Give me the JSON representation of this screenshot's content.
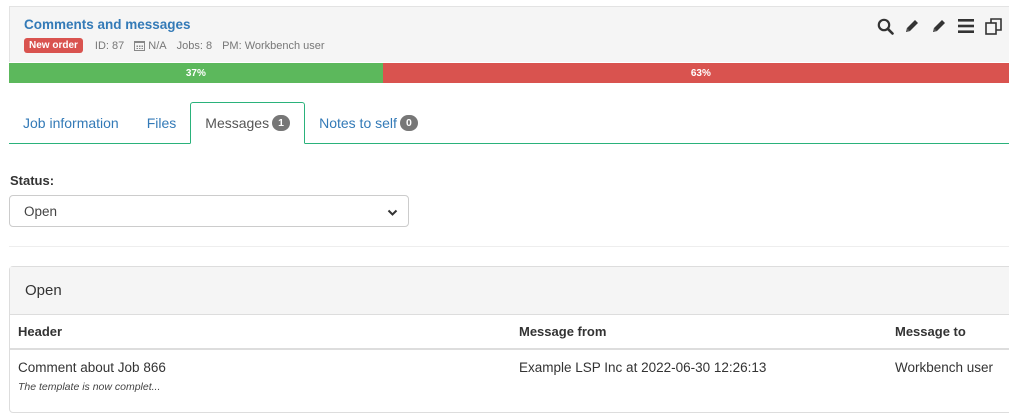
{
  "header": {
    "title": "Comments and messages",
    "badge": "New order",
    "id_text": "ID: 87",
    "date_text": "N/A",
    "jobs_text": "Jobs: 8",
    "pm_text": "PM: Workbench user"
  },
  "toolbar_icons": [
    "search-icon",
    "pencil-icon",
    "pencil-icon",
    "menu-icon",
    "copy-icon"
  ],
  "progress": {
    "done_percent": 37,
    "done_label": "37%",
    "remaining_percent": 63,
    "remaining_label": "63%",
    "done_color": "#5cb85c",
    "remaining_color": "#d9534f"
  },
  "tabs": [
    {
      "label": "Job information",
      "count": ""
    },
    {
      "label": "Files",
      "count": ""
    },
    {
      "label": "Messages",
      "count": "1"
    },
    {
      "label": "Notes to self",
      "count": "0"
    }
  ],
  "status": {
    "label": "Status:",
    "selected": "Open"
  },
  "messages_panel": {
    "title": "Open",
    "columns": [
      "Header",
      "Message from",
      "Message to"
    ],
    "rows": [
      {
        "header": "Comment about Job 866",
        "snippet": "The template is now complet...",
        "from": "Example LSP Inc at 2022-06-30 12:26:13",
        "to": "Workbench user"
      }
    ]
  },
  "accent_color": "#2ab27b",
  "link_color": "#337ab7"
}
